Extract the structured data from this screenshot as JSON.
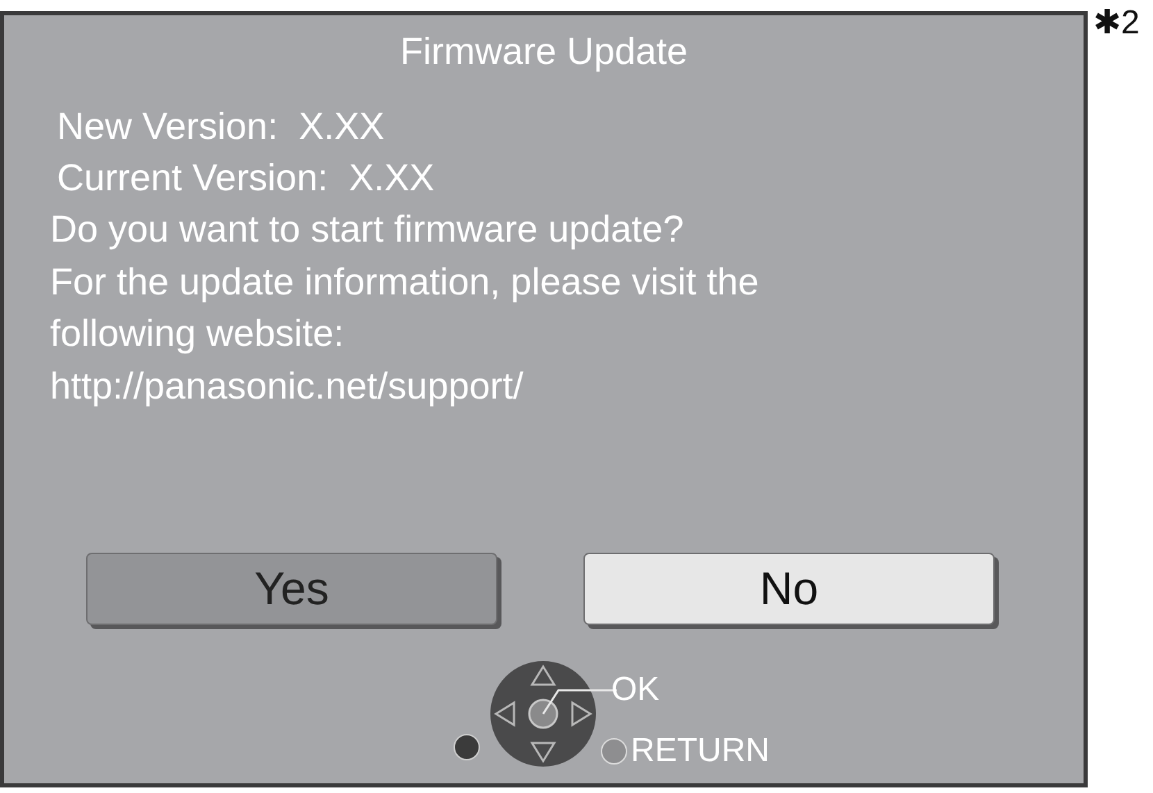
{
  "screen": {
    "title": "Firmware Update",
    "info_lines": [
      {
        "text": "New Version:  X.XX",
        "kind": "version"
      },
      {
        "text": "Current Version:  X.XX",
        "kind": "version"
      },
      {
        "text": "Do you want to start firmware update?",
        "kind": "message"
      },
      {
        "text": "For the update information, please visit the",
        "kind": "message"
      },
      {
        "text": "following website:",
        "kind": "message"
      },
      {
        "text": "http://panasonic.net/support/",
        "kind": "message"
      }
    ],
    "buttons": [
      {
        "label": "Yes",
        "selected": false
      },
      {
        "label": "No",
        "selected": true
      }
    ],
    "remote_hint": {
      "ok_label": "OK",
      "return_label": "RETURN"
    }
  },
  "footnote_mark": "✱2"
}
